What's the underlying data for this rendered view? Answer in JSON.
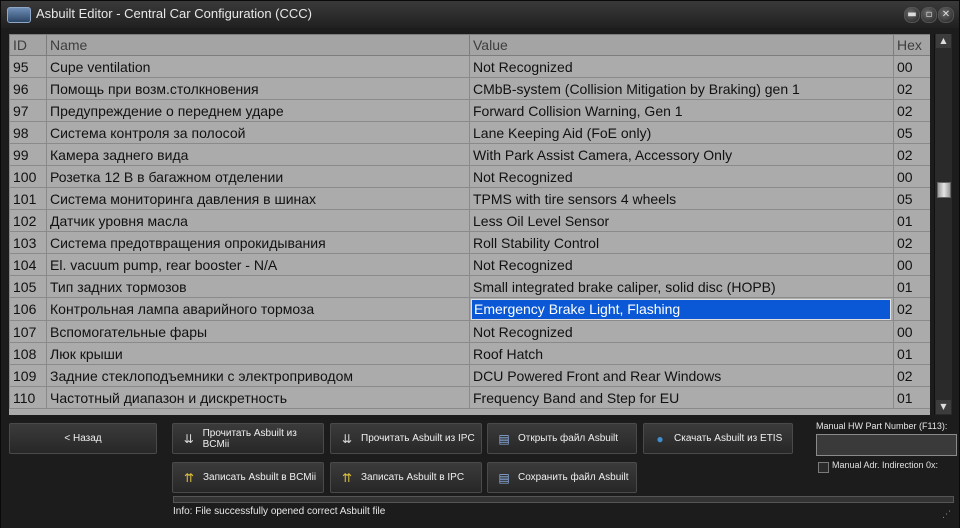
{
  "window": {
    "title": "Asbuilt Editor - Central Car Configuration (CCC)"
  },
  "table": {
    "columns": [
      "ID",
      "Name",
      "Value",
      "Hex"
    ],
    "rows": [
      {
        "id": "95",
        "name": "Cupe ventilation",
        "value": "Not Recognized",
        "hex": "00"
      },
      {
        "id": "96",
        "name": "Помощь при возм.столкновения",
        "value": "CMbB-system (Collision Mitigation by Braking) gen 1",
        "hex": "02"
      },
      {
        "id": "97",
        "name": "Предупреждение о переднем ударе",
        "value": "Forward Collision Warning, Gen 1",
        "hex": "02"
      },
      {
        "id": "98",
        "name": "Система контроля за полосой",
        "value": "Lane Keeping Aid (FoE only)",
        "hex": "05"
      },
      {
        "id": "99",
        "name": "Камера заднего вида",
        "value": "With Park Assist Camera, Accessory Only",
        "hex": "02"
      },
      {
        "id": "100",
        "name": "Розетка 12 В в багажном отделении",
        "value": "Not Recognized",
        "hex": "00"
      },
      {
        "id": "101",
        "name": "Система мониторинга давления в шинах",
        "value": "TPMS with tire sensors 4 wheels",
        "hex": "05"
      },
      {
        "id": "102",
        "name": "Датчик уровня масла",
        "value": "Less Oil Level Sensor",
        "hex": "01"
      },
      {
        "id": "103",
        "name": "Система предотвращения опрокидывания",
        "value": "Roll Stability Control",
        "hex": "02"
      },
      {
        "id": "104",
        "name": "El. vacuum pump, rear booster - N/A",
        "value": "Not Recognized",
        "hex": "00"
      },
      {
        "id": "105",
        "name": "Тип задних тормозов",
        "value": "Small integrated brake caliper, solid disc (HOPB)",
        "hex": "01"
      },
      {
        "id": "106",
        "name": "Контрольная лампа аварийного тормоза",
        "value": "Emergency Brake Light, Flashing",
        "hex": "02",
        "selected": true
      },
      {
        "id": "107",
        "name": "Вспомогательные фары",
        "value": "Not Recognized",
        "hex": "00"
      },
      {
        "id": "108",
        "name": "Люк крыши",
        "value": "Roof Hatch",
        "hex": "01"
      },
      {
        "id": "109",
        "name": "Задние стеклоподъемники с электроприводом",
        "value": "DCU Powered Front and Rear Windows",
        "hex": "02"
      },
      {
        "id": "110",
        "name": "Частотный диапазон и дискретность",
        "value": "Frequency Band and Step for EU",
        "hex": "01"
      }
    ]
  },
  "buttons": {
    "back": "< Назад",
    "read_bcm": "Прочитать Asbuilt из BCMii",
    "read_ipc": "Прочитать Asbuilt из IPC",
    "open_file": "Открыть файл Asbuilt",
    "download_etis": "Скачать Asbuilt из ETIS",
    "write_bcm": "Записать Asbuilt в BCMii",
    "write_ipc": "Записать Asbuilt в IPC",
    "save_file": "Сохранить файл Asbuilt"
  },
  "manual_hw": {
    "label": "Manual HW Part Number (F113):",
    "value": ""
  },
  "manual_adr": {
    "label": "Manual Adr. Indirection 0x:"
  },
  "status": "Info: File successfully opened correct Asbuilt file",
  "colors": {
    "selection": "#0a58d6",
    "grid_bg": "#ababab"
  }
}
